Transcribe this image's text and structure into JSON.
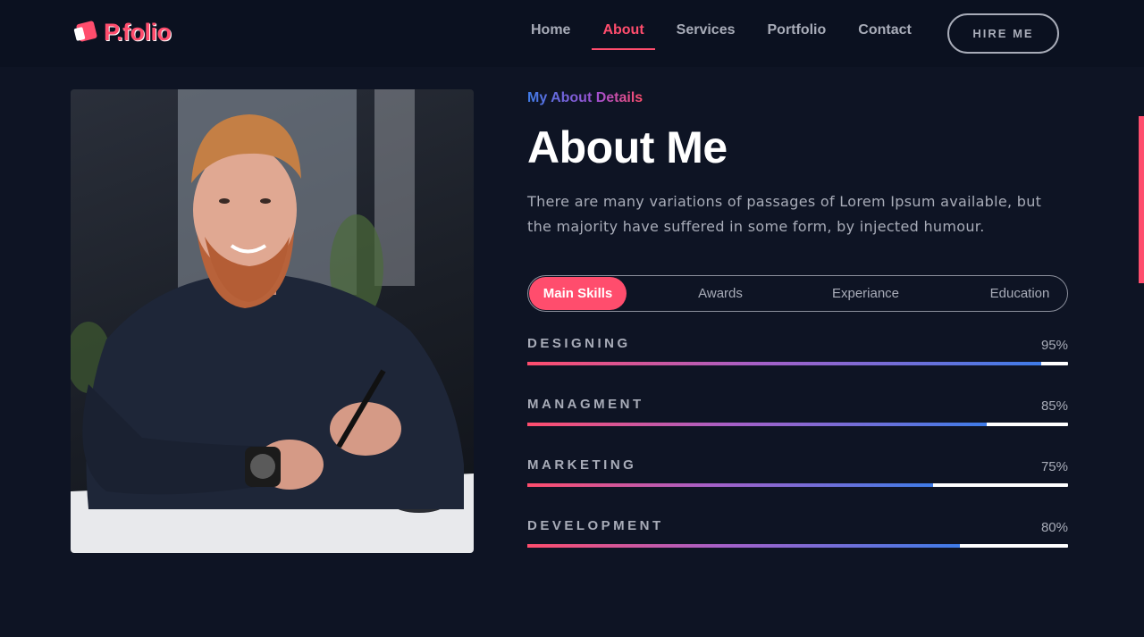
{
  "brand": {
    "name": "P.folio"
  },
  "nav": {
    "items": [
      {
        "label": "Home"
      },
      {
        "label": "About"
      },
      {
        "label": "Services"
      },
      {
        "label": "Portfolio"
      },
      {
        "label": "Contact"
      }
    ],
    "active": "About",
    "cta_label": "HIRE ME"
  },
  "about": {
    "kicker": "My About Details",
    "title": "About Me",
    "intro": "There are many variations of passages of Lorem Ipsum available, but the majority have suffered in some form, by injected humour."
  },
  "tabs": [
    {
      "label": "Main Skills",
      "active": true
    },
    {
      "label": "Awards"
    },
    {
      "label": "Experiance"
    },
    {
      "label": "Education"
    }
  ],
  "skills": [
    {
      "name": "DESIGNING",
      "percent_label": "95%",
      "value": 95
    },
    {
      "name": "MANAGMENT",
      "percent_label": "85%",
      "value": 85
    },
    {
      "name": "MARKETING",
      "percent_label": "75%",
      "value": 75
    },
    {
      "name": "DEVELOPMENT",
      "percent_label": "80%",
      "value": 80
    }
  ],
  "colors": {
    "accent": "#ff4d6d",
    "accent_blue": "#3f7ce8",
    "background": "#0e1424",
    "header_bg": "#0b1120"
  },
  "icons": {
    "logo": "logo-mark-icon"
  }
}
